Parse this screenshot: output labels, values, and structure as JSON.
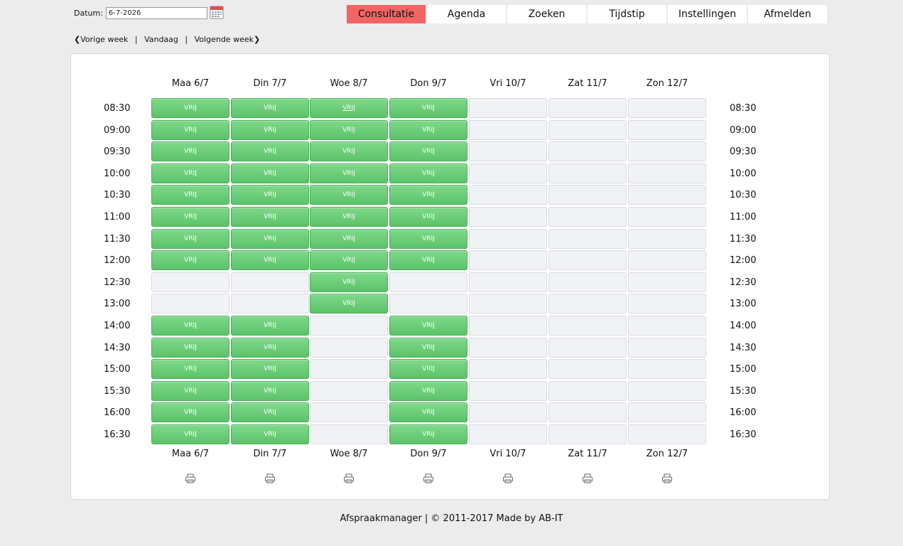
{
  "date_picker": {
    "label": "Datum:",
    "value": "6-7-2026",
    "icon": "calendar-icon"
  },
  "nav": {
    "items": [
      {
        "label": "Consultatie",
        "active": true
      },
      {
        "label": "Agenda",
        "active": false
      },
      {
        "label": "Zoeken",
        "active": false
      },
      {
        "label": "Tijdstip",
        "active": false
      },
      {
        "label": "Instellingen",
        "active": false
      },
      {
        "label": "Afmelden",
        "active": false
      }
    ],
    "active_color": "#f36464"
  },
  "week_nav": {
    "prev": "Vorige week",
    "today": "Vandaag",
    "next": "Volgende week",
    "separator": "|"
  },
  "schedule": {
    "days": [
      "Maa 6/7",
      "Din 7/7",
      "Woe 8/7",
      "Don 9/7",
      "Vri 10/7",
      "Zat 11/7",
      "Zon 12/7"
    ],
    "times": [
      "08:30",
      "09:00",
      "09:30",
      "10:00",
      "10:30",
      "11:00",
      "11:30",
      "12:00",
      "12:30",
      "13:00",
      "14:00",
      "14:30",
      "15:00",
      "15:30",
      "16:00",
      "16:30"
    ],
    "free_label": "VRIJ",
    "free_color": "#5cc36a",
    "empty_color": "#f1f2f5",
    "free_matrix": [
      [
        1,
        1,
        1,
        1,
        0,
        0,
        0
      ],
      [
        1,
        1,
        1,
        1,
        0,
        0,
        0
      ],
      [
        1,
        1,
        1,
        1,
        0,
        0,
        0
      ],
      [
        1,
        1,
        1,
        1,
        0,
        0,
        0
      ],
      [
        1,
        1,
        1,
        1,
        0,
        0,
        0
      ],
      [
        1,
        1,
        1,
        1,
        0,
        0,
        0
      ],
      [
        1,
        1,
        1,
        1,
        0,
        0,
        0
      ],
      [
        1,
        1,
        1,
        1,
        0,
        0,
        0
      ],
      [
        0,
        0,
        1,
        0,
        0,
        0,
        0
      ],
      [
        0,
        0,
        1,
        0,
        0,
        0,
        0
      ],
      [
        1,
        1,
        0,
        1,
        0,
        0,
        0
      ],
      [
        1,
        1,
        0,
        1,
        0,
        0,
        0
      ],
      [
        1,
        1,
        0,
        1,
        0,
        0,
        0
      ],
      [
        1,
        1,
        0,
        1,
        0,
        0,
        0
      ],
      [
        1,
        1,
        0,
        1,
        0,
        0,
        0
      ],
      [
        1,
        1,
        0,
        1,
        0,
        0,
        0
      ]
    ],
    "print_icon": "printer-icon"
  },
  "footer": {
    "text": "Afspraakmanager | © 2011-2017 Made by AB-IT"
  }
}
